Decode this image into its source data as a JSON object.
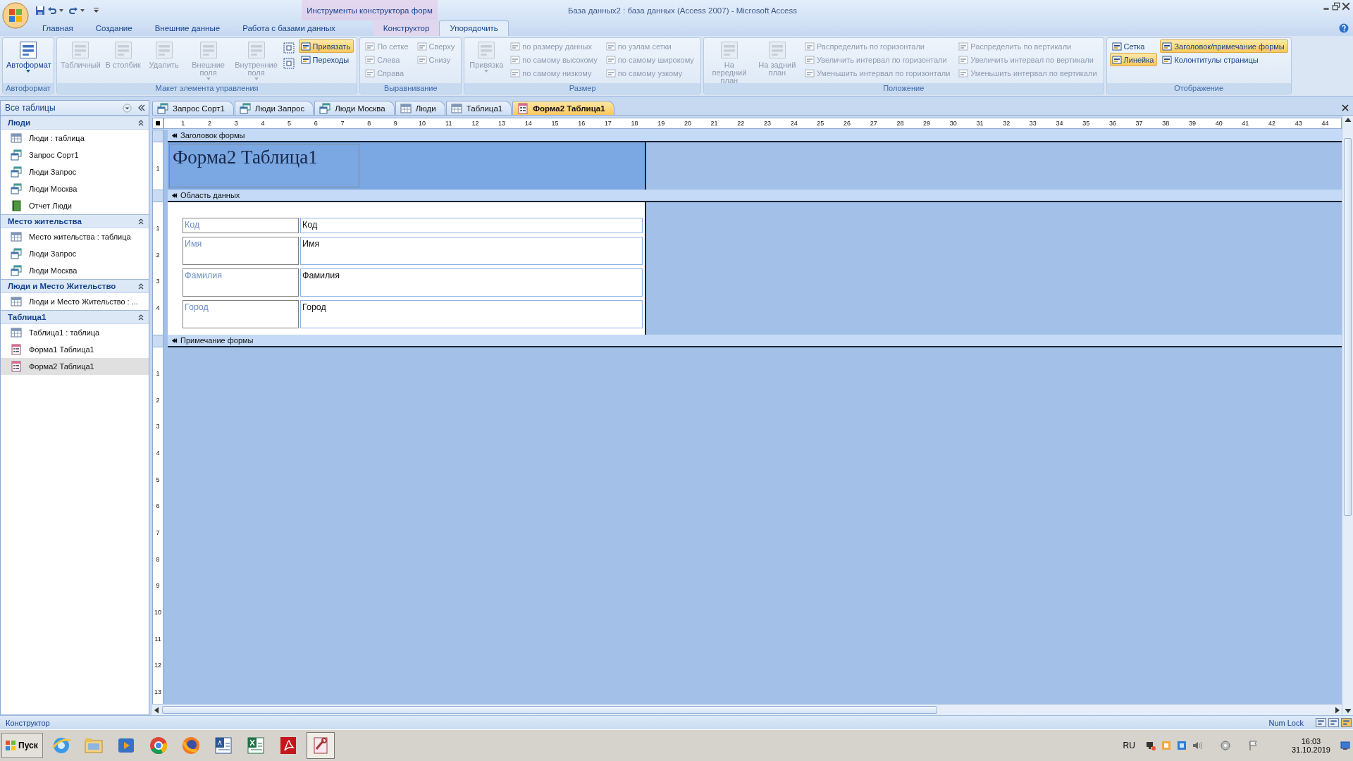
{
  "title_bar": {
    "title": "База данных2 : база данных (Access 2007) - Microsoft Access",
    "context_label": "Инструменты конструктора форм"
  },
  "ribbon_tabs": [
    {
      "label": "Главная",
      "selected": false,
      "contextual": false
    },
    {
      "label": "Создание",
      "selected": false,
      "contextual": false
    },
    {
      "label": "Внешние данные",
      "selected": false,
      "contextual": false
    },
    {
      "label": "Работа с базами данных",
      "selected": false,
      "contextual": false
    },
    {
      "label": "Конструктор",
      "selected": false,
      "contextual": true
    },
    {
      "label": "Упорядочить",
      "selected": true,
      "contextual": true
    }
  ],
  "ribbon_groups": [
    {
      "label": "Автоформат",
      "columns": [
        [
          {
            "label": "Автоформат",
            "kind": "large",
            "disabled": false,
            "on": false,
            "dropdown": true
          }
        ]
      ]
    },
    {
      "label": "Макет элемента управления",
      "columns": [
        [
          {
            "label": "Табличный",
            "kind": "large",
            "disabled": true,
            "on": false,
            "dropdown": false
          }
        ],
        [
          {
            "label": "В столбик",
            "kind": "large",
            "disabled": true,
            "on": false,
            "dropdown": false
          }
        ],
        [
          {
            "label": "Удалить",
            "kind": "large",
            "disabled": true,
            "on": false,
            "dropdown": false
          }
        ],
        [
          {
            "label": "Внешние поля",
            "kind": "large",
            "disabled": true,
            "on": false,
            "dropdown": true
          }
        ],
        [
          {
            "label": "Внутренние поля",
            "kind": "large",
            "disabled": true,
            "on": false,
            "dropdown": true
          }
        ],
        [
          {
            "kind": "icon",
            "disabled": false,
            "on": false,
            "dropdown": false
          },
          {
            "kind": "icon",
            "disabled": false,
            "on": false,
            "dropdown": false
          }
        ],
        [
          {
            "label": "Привязать",
            "kind": "small",
            "disabled": false,
            "on": true,
            "dropdown": false
          },
          {
            "label": "Переходы",
            "kind": "small",
            "disabled": false,
            "on": false,
            "dropdown": false
          }
        ]
      ]
    },
    {
      "label": "Выравнивание",
      "columns": [
        [
          {
            "label": "По сетке",
            "kind": "small",
            "disabled": true,
            "on": false,
            "dropdown": false
          },
          {
            "label": "Слева",
            "kind": "small",
            "disabled": true,
            "on": false,
            "dropdown": false
          },
          {
            "label": "Справа",
            "kind": "small",
            "disabled": true,
            "on": false,
            "dropdown": false
          }
        ],
        [
          {
            "label": "Сверху",
            "kind": "small",
            "disabled": true,
            "on": false,
            "dropdown": false
          },
          {
            "label": "Снизу",
            "kind": "small",
            "disabled": true,
            "on": false,
            "dropdown": false
          }
        ]
      ]
    },
    {
      "label": "Размер",
      "columns": [
        [
          {
            "label": "Привязка",
            "kind": "large",
            "disabled": true,
            "on": false,
            "dropdown": true
          }
        ],
        [
          {
            "label": "по размеру данных",
            "kind": "small",
            "disabled": true,
            "on": false,
            "dropdown": false
          },
          {
            "label": "по самому высокому",
            "kind": "small",
            "disabled": true,
            "on": false,
            "dropdown": false
          },
          {
            "label": "по самому низкому",
            "kind": "small",
            "disabled": true,
            "on": false,
            "dropdown": false
          }
        ],
        [
          {
            "label": "по узлам сетки",
            "kind": "small",
            "disabled": true,
            "on": false,
            "dropdown": false
          },
          {
            "label": "по самому широкому",
            "kind": "small",
            "disabled": true,
            "on": false,
            "dropdown": false
          },
          {
            "label": "по самому узкому",
            "kind": "small",
            "disabled": true,
            "on": false,
            "dropdown": false
          }
        ]
      ]
    },
    {
      "label": "Положение",
      "columns": [
        [
          {
            "label": "На передний план",
            "kind": "large",
            "disabled": true,
            "on": false,
            "dropdown": false
          }
        ],
        [
          {
            "label": "На задний план",
            "kind": "large",
            "disabled": true,
            "on": false,
            "dropdown": false
          }
        ],
        [
          {
            "label": "Распределить по горизонтали",
            "kind": "small",
            "disabled": true,
            "on": false,
            "dropdown": false
          },
          {
            "label": "Увеличить интервал по горизонтали",
            "kind": "small",
            "disabled": true,
            "on": false,
            "dropdown": false
          },
          {
            "label": "Уменьшить интервал по горизонтали",
            "kind": "small",
            "disabled": true,
            "on": false,
            "dropdown": false
          }
        ],
        [
          {
            "label": "Распределить по вертикали",
            "kind": "small",
            "disabled": true,
            "on": false,
            "dropdown": false
          },
          {
            "label": "Увеличить интервал по вертикали",
            "kind": "small",
            "disabled": true,
            "on": false,
            "dropdown": false
          },
          {
            "label": "Уменьшить интервал по вертикали",
            "kind": "small",
            "disabled": true,
            "on": false,
            "dropdown": false
          }
        ]
      ]
    },
    {
      "label": "Отображение",
      "columns": [
        [
          {
            "label": "Сетка",
            "kind": "small",
            "disabled": false,
            "on": false,
            "dropdown": false
          },
          {
            "label": "Линейка",
            "kind": "small",
            "disabled": false,
            "on": true,
            "dropdown": false
          }
        ],
        [
          {
            "label": "Заголовок/примечание формы",
            "kind": "small",
            "disabled": false,
            "on": true,
            "dropdown": false
          },
          {
            "label": "Колонтитулы страницы",
            "kind": "small",
            "disabled": false,
            "on": false,
            "dropdown": false
          }
        ]
      ]
    }
  ],
  "navigation": {
    "title": "Все таблицы",
    "groups": [
      {
        "title": "Люди",
        "expanded": true,
        "items": [
          {
            "label": "Люди : таблица",
            "kind": "table",
            "selected": false
          },
          {
            "label": "Запрос Сорт1",
            "kind": "query",
            "selected": false
          },
          {
            "label": "Люди Запрос",
            "kind": "query",
            "selected": false
          },
          {
            "label": "Люди Москва",
            "kind": "query",
            "selected": false
          },
          {
            "label": "Отчет Люди",
            "kind": "report",
            "selected": false
          }
        ]
      },
      {
        "title": "Место жительства",
        "expanded": true,
        "items": [
          {
            "label": "Место жительства : таблица",
            "kind": "table",
            "selected": false
          },
          {
            "label": "Люди Запрос",
            "kind": "query",
            "selected": false
          },
          {
            "label": "Люди Москва",
            "kind": "query",
            "selected": false
          }
        ]
      },
      {
        "title": "Люди и Место Жительство",
        "expanded": true,
        "items": [
          {
            "label": "Люди и Место Жительство : ...",
            "kind": "table",
            "selected": false
          }
        ]
      },
      {
        "title": "Таблица1",
        "expanded": true,
        "items": [
          {
            "label": "Таблица1 : таблица",
            "kind": "table",
            "selected": false
          },
          {
            "label": "Форма1 Таблица1",
            "kind": "form",
            "selected": false
          },
          {
            "label": "Форма2 Таблица1",
            "kind": "form",
            "selected": true
          }
        ]
      }
    ]
  },
  "document_tabs": [
    {
      "label": "Запрос Сорт1",
      "kind": "query",
      "selected": false
    },
    {
      "label": "Люди Запрос",
      "kind": "query",
      "selected": false
    },
    {
      "label": "Люди Москва",
      "kind": "query",
      "selected": false
    },
    {
      "label": "Люди",
      "kind": "table",
      "selected": false
    },
    {
      "label": "Таблица1",
      "kind": "table",
      "selected": false
    },
    {
      "label": "Форма2 Таблица1",
      "kind": "form",
      "selected": true
    }
  ],
  "ruler": [
    "1",
    "2",
    "3",
    "4",
    "5",
    "6",
    "7",
    "8",
    "9",
    "10",
    "11",
    "12",
    "13",
    "14",
    "15",
    "16",
    "17",
    "18",
    "19",
    "20",
    "21",
    "22",
    "23",
    "24",
    "25",
    "26",
    "27",
    "28",
    "29",
    "30",
    "31",
    "32",
    "33",
    "34",
    "35",
    "36",
    "37",
    "38",
    "39",
    "40",
    "41",
    "42",
    "43",
    "44"
  ],
  "form": {
    "sections": [
      {
        "kind": "header",
        "title": "Заголовок формы",
        "ruler": [
          "1"
        ],
        "caption": "Форма2 Таблица1"
      },
      {
        "kind": "detail",
        "title": "Область данных",
        "ruler": [
          "1",
          "2",
          "3",
          "4"
        ],
        "fields": [
          {
            "label": "Код",
            "value": "Код"
          },
          {
            "label": "Имя",
            "value": "Имя"
          },
          {
            "label": "Фамилия",
            "value": "Фамилия"
          },
          {
            "label": "Город",
            "value": "Город"
          }
        ]
      },
      {
        "kind": "footer",
        "title": "Примечание формы",
        "ruler": [
          "1",
          "2",
          "3",
          "4",
          "5",
          "6",
          "7",
          "8",
          "9",
          "10",
          "11",
          "12",
          "13"
        ]
      }
    ]
  },
  "status_bar": {
    "mode": "Конструктор",
    "indicator": "Num Lock",
    "views": [
      {
        "selected": false
      },
      {
        "selected": false
      },
      {
        "selected": true
      }
    ]
  },
  "taskbar": {
    "start": "Пуск",
    "apps": [
      {
        "kind": "browser",
        "selected": false
      },
      {
        "kind": "folder",
        "selected": false
      },
      {
        "kind": "player",
        "selected": false
      },
      {
        "kind": "chrome",
        "selected": false
      },
      {
        "kind": "firefox",
        "selected": false
      },
      {
        "kind": "word",
        "selected": false
      },
      {
        "kind": "excel",
        "selected": false
      },
      {
        "kind": "pdf",
        "selected": false
      },
      {
        "kind": "access",
        "selected": true
      }
    ],
    "language": "RU",
    "time": "16:03",
    "date": "31.10.2019"
  }
}
